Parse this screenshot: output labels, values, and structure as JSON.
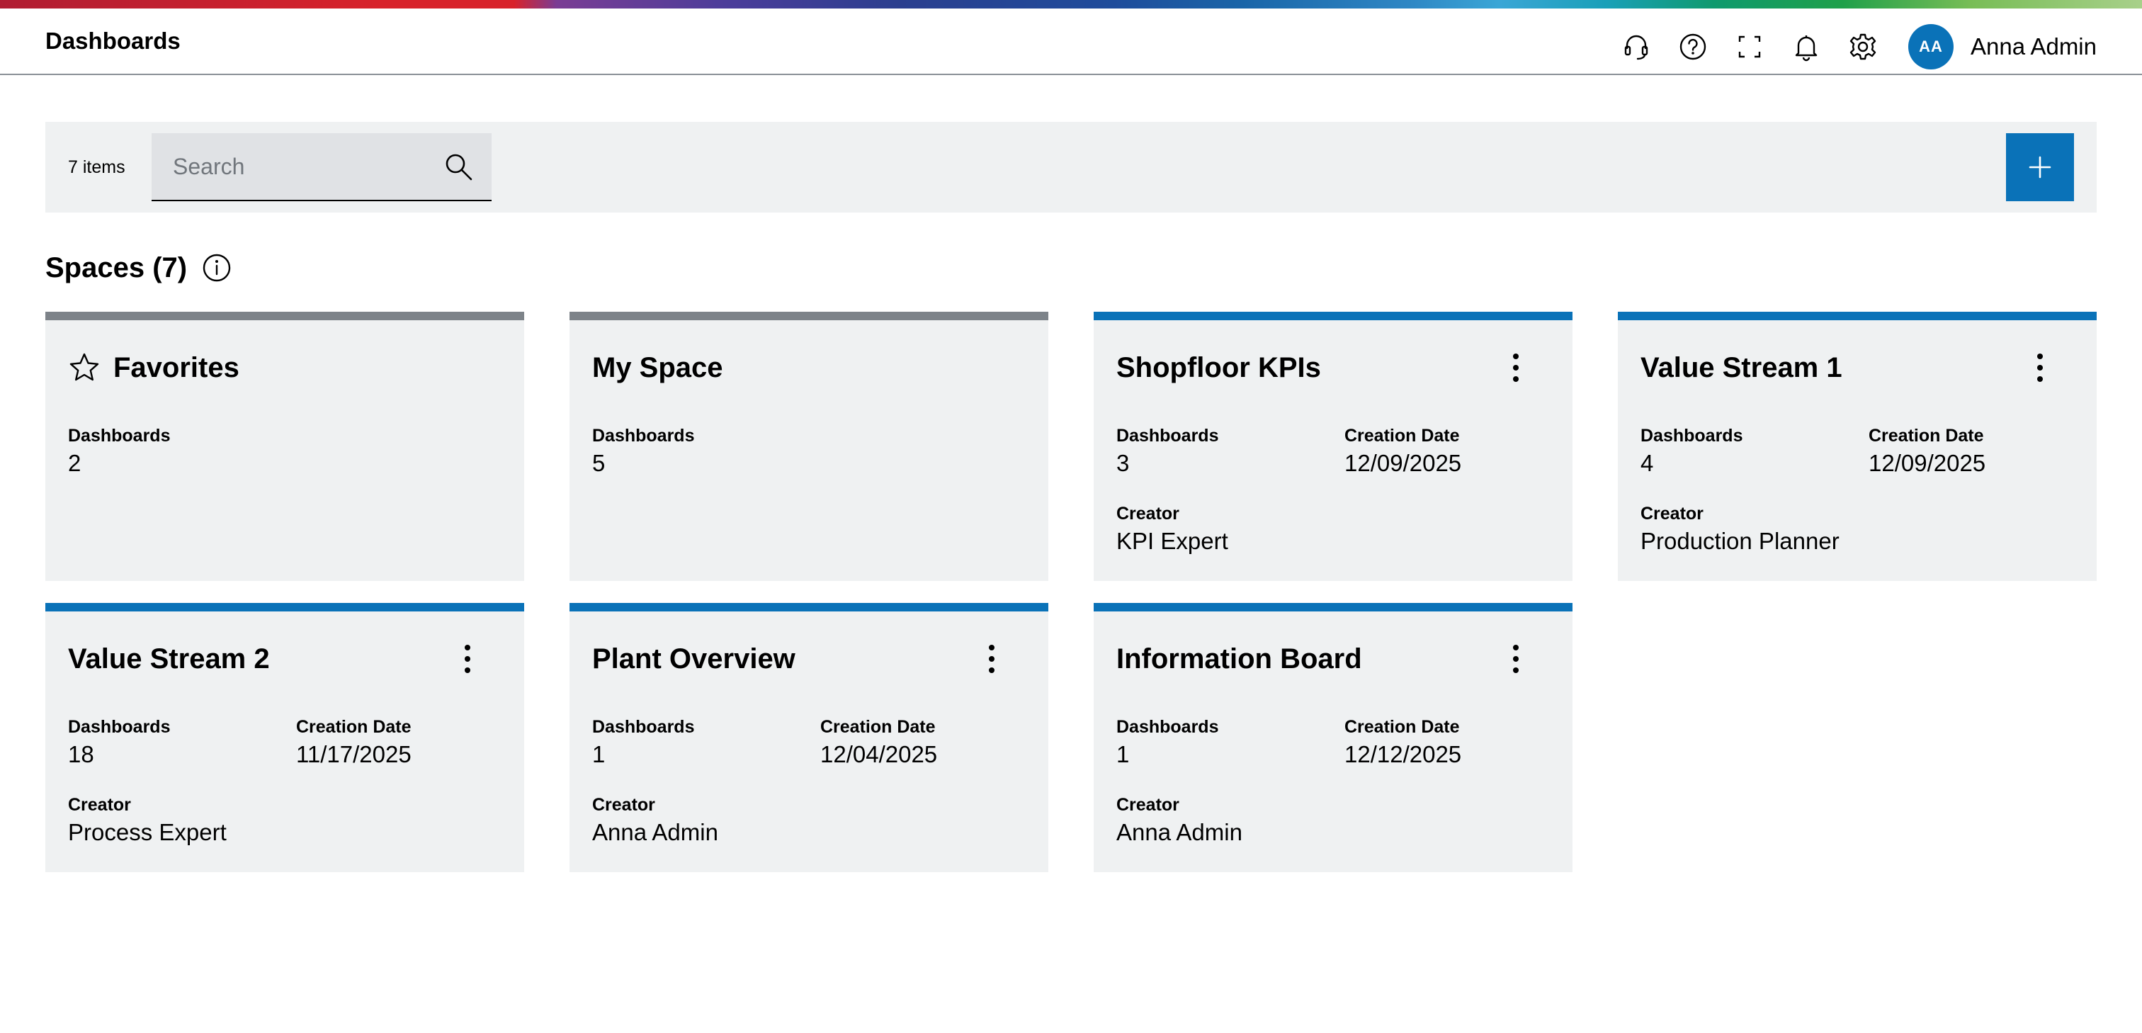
{
  "header": {
    "title": "Dashboards",
    "user": {
      "initials": "AA",
      "name": "Anna Admin"
    },
    "icons": [
      "headset-icon",
      "help-icon",
      "fullscreen-icon",
      "notification-bell-icon",
      "settings-gear-icon"
    ]
  },
  "toolbar": {
    "item_count": "7 items",
    "search_placeholder": "Search",
    "search_value": "",
    "add_icon": "plus-icon",
    "accent_color": "#0a72b8"
  },
  "section": {
    "title": "Spaces (7)"
  },
  "spaces": [
    {
      "title": "Favorites",
      "dashboards_label": "Dashboards",
      "dashboards": "2"
    },
    {
      "title": "My Space",
      "dashboards_label": "Dashboards",
      "dashboards": "5"
    },
    {
      "title": "Shopfloor KPIs",
      "dashboards_label": "Dashboards",
      "dashboards": "3",
      "date_label": "Creation Date",
      "date": "12/09/2025",
      "creator_label": "Creator",
      "creator": "KPI Expert"
    },
    {
      "title": "Value Stream 1",
      "dashboards_label": "Dashboards",
      "dashboards": "4",
      "date_label": "Creation Date",
      "date": "12/09/2025",
      "creator_label": "Creator",
      "creator": "Production Planner"
    },
    {
      "title": "Value Stream 2",
      "dashboards_label": "Dashboards",
      "dashboards": "18",
      "date_label": "Creation Date",
      "date": "11/17/2025",
      "creator_label": "Creator",
      "creator": "Process Expert"
    },
    {
      "title": "Plant Overview",
      "dashboards_label": "Dashboards",
      "dashboards": "1",
      "date_label": "Creation Date",
      "date": "12/04/2025",
      "creator_label": "Creator",
      "creator": "Anna Admin"
    },
    {
      "title": "Information Board",
      "dashboards_label": "Dashboards",
      "dashboards": "1",
      "date_label": "Creation Date",
      "date": "12/12/2025",
      "creator_label": "Creator",
      "creator": "Anna Admin"
    }
  ],
  "colors": {
    "card_accent": "#0a72b8",
    "card_accent_personal": "#7d8389",
    "card_background": "#eff1f2"
  }
}
